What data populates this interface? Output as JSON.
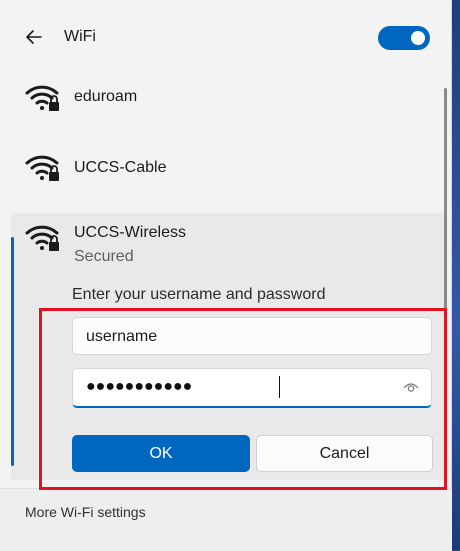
{
  "header": {
    "title": "WiFi",
    "wifi_enabled": true
  },
  "networks": [
    {
      "name": "eduroam"
    },
    {
      "name": "UCCS-Cable"
    },
    {
      "name": "UCCS-Wireless",
      "status": "Secured"
    }
  ],
  "login": {
    "prompt": "Enter your username and password",
    "username_value": "username",
    "password_masked": "●●●●●●●●●●●",
    "ok_label": "OK",
    "cancel_label": "Cancel"
  },
  "footer": {
    "link": "More Wi-Fi settings"
  },
  "colors": {
    "accent": "#0067c0",
    "highlight": "#e0141e"
  }
}
